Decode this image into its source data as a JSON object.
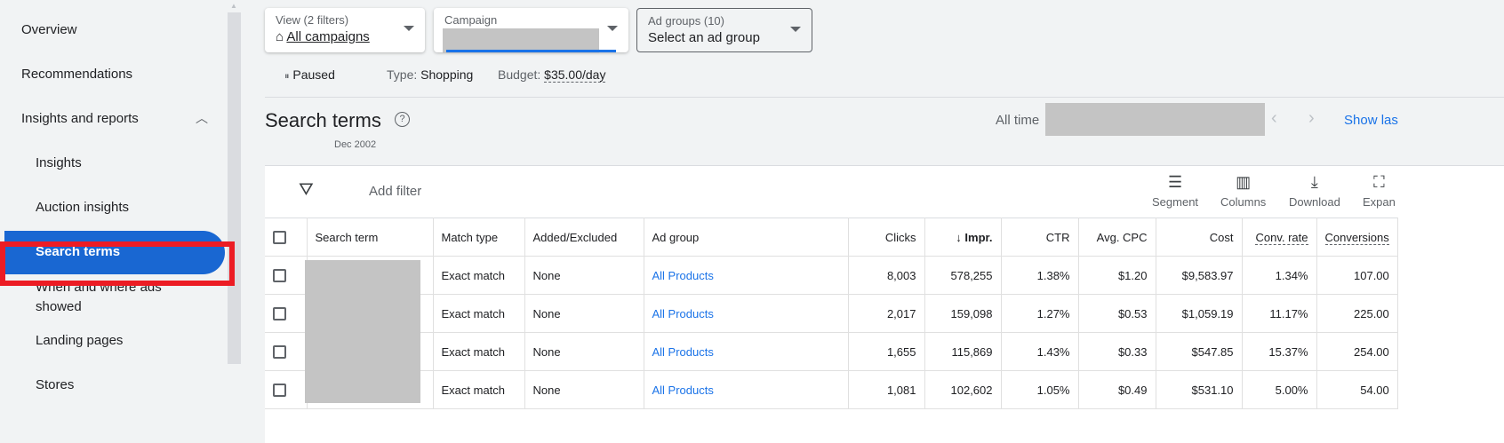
{
  "sidebar": {
    "items": [
      {
        "label": "Overview"
      },
      {
        "label": "Recommendations"
      },
      {
        "label": "Insights and reports"
      },
      {
        "label": "Insights"
      },
      {
        "label": "Auction insights"
      },
      {
        "label": "Search terms"
      },
      {
        "label": "When and where ads showed"
      },
      {
        "label": "Landing pages"
      },
      {
        "label": "Stores"
      }
    ]
  },
  "filters": {
    "view_label": "View (2 filters)",
    "view_value": "All campaigns",
    "campaign_label": "Campaign",
    "adgroups_label": "Ad groups (10)",
    "adgroups_value": "Select an ad group"
  },
  "meta": {
    "status": "Paused",
    "type_label": "Type:",
    "type_value": "Shopping",
    "budget_label": "Budget:",
    "budget_value": "$35.00/day"
  },
  "page": {
    "title": "Search terms",
    "help": "?",
    "date_sub": "Dec 2002",
    "date_range": "All time",
    "show_last": "Show las"
  },
  "toolbar": {
    "add_filter": "Add filter",
    "segment": "Segment",
    "columns": "Columns",
    "download": "Download",
    "expand": "Expan"
  },
  "table": {
    "headers": [
      "Search term",
      "Match type",
      "Added/Excluded",
      "Ad group",
      "Clicks",
      "Impr.",
      "CTR",
      "Avg. CPC",
      "Cost",
      "Conv. rate",
      "Conversions"
    ],
    "sort_indicator": "↓",
    "rows": [
      [
        "",
        "Exact match",
        "None",
        "All Products",
        "8,003",
        "578,255",
        "1.38%",
        "$1.20",
        "$9,583.97",
        "1.34%",
        "107.00"
      ],
      [
        "",
        "Exact match",
        "None",
        "All Products",
        "2,017",
        "159,098",
        "1.27%",
        "$0.53",
        "$1,059.19",
        "11.17%",
        "225.00"
      ],
      [
        "",
        "Exact match",
        "None",
        "All Products",
        "1,655",
        "115,869",
        "1.43%",
        "$0.33",
        "$547.85",
        "15.37%",
        "254.00"
      ],
      [
        "",
        "Exact match",
        "None",
        "All Products",
        "1,081",
        "102,602",
        "1.05%",
        "$0.49",
        "$531.10",
        "5.00%",
        "54.00"
      ]
    ]
  },
  "colors": {
    "accent": "#1967d2",
    "highlight": "#ec1c24",
    "link": "#1a73e8"
  }
}
